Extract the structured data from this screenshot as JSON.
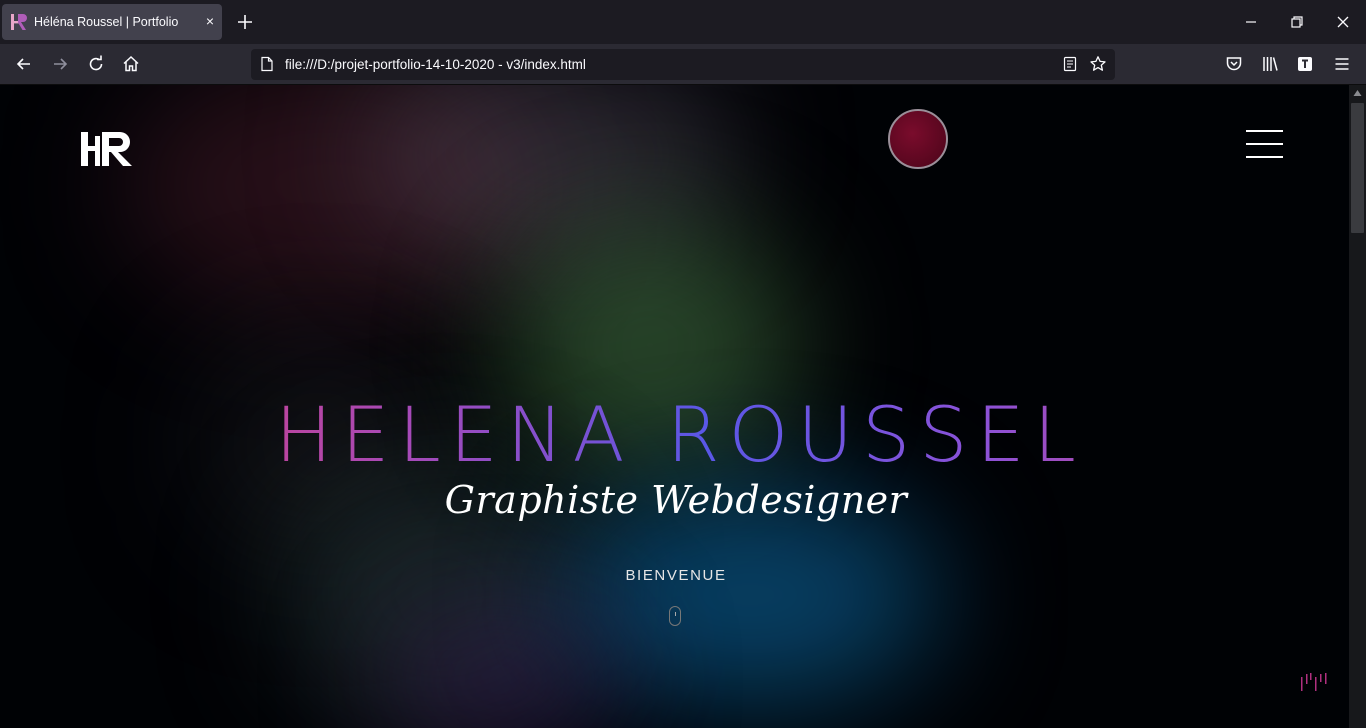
{
  "browser": {
    "tab_title": "Héléna Roussel | Portfolio",
    "tab_close": "×",
    "url": "file:///D:/projet-portfolio-14-10-2020 - v3/index.html",
    "icons": [
      "hr-favicon-icon",
      "close-icon",
      "plus-icon",
      "minimize-icon",
      "restore-icon",
      "window-close-icon",
      "back-arrow-icon",
      "forward-arrow-icon",
      "reload-icon",
      "home-icon",
      "page-icon",
      "reader-view-icon",
      "bookmark-star-icon",
      "pocket-icon",
      "library-icon",
      "extension-icon",
      "hamburger-menu-icon"
    ]
  },
  "page": {
    "hero": {
      "name": "HELENA ROUSSEL",
      "subtitle": "Graphiste Webdesigner",
      "welcome": "BIENVENUE"
    },
    "colors": {
      "background": "#000205",
      "gradient_start": "#e53a6c",
      "gradient_mid": "#5a57e6",
      "gradient_end": "#e23c6a",
      "cursor_dot": "#7a0c2c",
      "bars_accent": "#b0307f"
    }
  }
}
